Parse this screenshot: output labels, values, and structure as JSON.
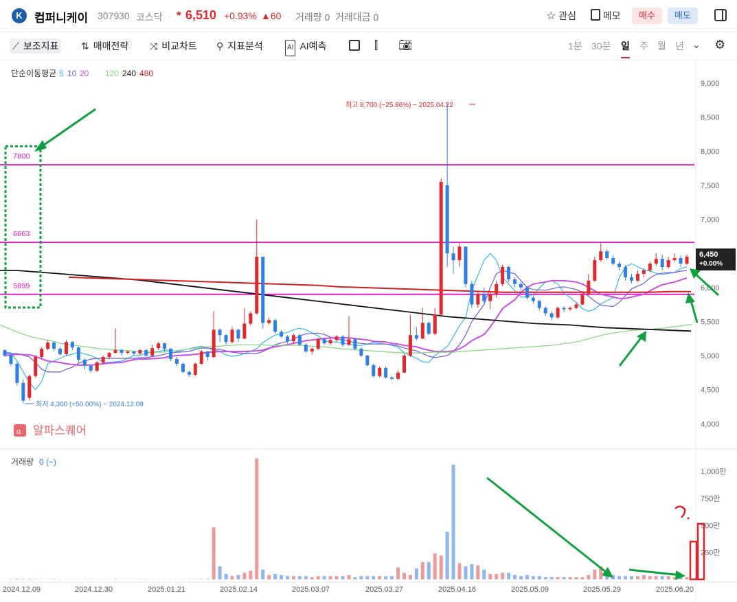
{
  "header": {
    "logo_glyph": "꒰",
    "name": "컴퍼니케이",
    "code": "307930",
    "market": "코스닥",
    "star": "*",
    "price": "6,510",
    "change_pct": "+0.93%",
    "change_abs": "▲60",
    "volume_label": "거래량 0",
    "amount_label": "거래대금 0",
    "watch_label": "관심",
    "memo_label": "메모",
    "buy_label": "매수",
    "sell_label": "매도"
  },
  "toolbar": {
    "tools": [
      "보조지표",
      "매매전략",
      "비교차트",
      "지표분석",
      "AI예측"
    ],
    "periods": [
      "1분",
      "30분",
      "일",
      "주",
      "월",
      "년"
    ],
    "active_period": "일"
  },
  "colors": {
    "up": "#e0282e",
    "down": "#2f7ee6",
    "ma5": "#35b8e6",
    "ma10": "#6a5ae0",
    "ma20": "#c84fe0",
    "ma120": "#7fd87a",
    "ma240": "#111111",
    "ma480": "#d41e1e",
    "hline": "#e020c8",
    "annot": "#10a040"
  },
  "chart_data": {
    "type": "candlestick",
    "ma_legend": {
      "title": "단순이동평균",
      "items": [
        {
          "label": "5",
          "color": "#35b8e6"
        },
        {
          "label": "10",
          "color": "#6a5ae0"
        },
        {
          "label": "20",
          "color": "#c84fe0"
        },
        {
          "label": "120",
          "color": "#7fd87a"
        },
        {
          "label": "240",
          "color": "#111111"
        },
        {
          "label": "480",
          "color": "#d41e1e"
        }
      ]
    },
    "price_axis": {
      "ticks": [
        "9,000",
        "8,500",
        "8,000",
        "7,500",
        "7,000",
        "6,500",
        "6,000",
        "5,500",
        "5,000",
        "4,500",
        "4,000"
      ],
      "values": [
        9000,
        8500,
        8000,
        7500,
        7000,
        6500,
        6000,
        5500,
        5000,
        4500,
        4000
      ]
    },
    "x_labels": [
      "2024.12.09",
      "2024.12.30",
      "2025.01.21",
      "2025.02.14",
      "2025.03.07",
      "2025.03.27",
      "2025.04.16",
      "2025.05.09",
      "2025.05.29",
      "2025.06.20"
    ],
    "current_price_tag": {
      "price": "6,450",
      "pct": "+0.00%"
    },
    "high_label": "최고 8,700 (−25.86%) − 2025.04.22",
    "low_label": "최저 4,300 (+50.00%) − 2024.12.09",
    "horizontal_lines": [
      {
        "label": "7800",
        "value": 7800
      },
      {
        "label": "6663",
        "value": 6663
      },
      {
        "label": "5899",
        "value": 5899
      }
    ],
    "watermark": "알파스퀘어",
    "volume": {
      "title": "거래량",
      "value_text": "0 (−)",
      "ticks": [
        "1,000만",
        "750만",
        "500만",
        "250만"
      ],
      "tick_values": [
        1000,
        750,
        500,
        250
      ],
      "unit": "만"
    },
    "series": [
      {
        "name": "5",
        "values": [
          5050,
          5040,
          4920,
          4600,
          4500,
          4620,
          4880,
          4960,
          5000,
          5020,
          5050,
          5000,
          4960,
          4900,
          4900,
          4920,
          4960,
          5000,
          5000,
          5040,
          5060,
          5080,
          5080,
          5060,
          5100,
          5120,
          5140,
          5110,
          5060,
          5010,
          4990,
          5000,
          5030,
          5100,
          5190,
          5250,
          5300,
          5340,
          5380,
          5400,
          5380,
          5290,
          5220,
          5200,
          5200,
          5170,
          5150,
          5150,
          5170,
          5190,
          5170,
          5150,
          5120,
          5040,
          4960,
          4910,
          4900,
          5000,
          5130,
          5280,
          5440,
          5560,
          5960,
          6400,
          6500,
          6400,
          6150,
          5950,
          5860,
          5860,
          5900,
          6080,
          6100,
          6050,
          5920,
          5780,
          5690,
          5650,
          5680,
          5760,
          5850,
          6150,
          6300,
          6350,
          6260,
          6240,
          6210,
          6190,
          6220,
          6280,
          6300
        ]
      },
      {
        "name": "10",
        "values": [
          5030,
          5030,
          5030,
          4980,
          4900,
          4800,
          4760,
          4760,
          4800,
          4830,
          4890,
          4950,
          4960,
          4960,
          4960,
          4960,
          4960,
          4960,
          4970,
          4970,
          5000,
          5020,
          5040,
          5050,
          5060,
          5090,
          5110,
          5110,
          5090,
          5070,
          5050,
          5040,
          5030,
          5030,
          5060,
          5100,
          5160,
          5210,
          5240,
          5290,
          5320,
          5330,
          5310,
          5270,
          5240,
          5210,
          5190,
          5180,
          5170,
          5170,
          5170,
          5160,
          5140,
          5110,
          5070,
          5030,
          4990,
          4970,
          5000,
          5060,
          5160,
          5300,
          5500,
          5750,
          6000,
          6200,
          6250,
          6200,
          6100,
          6000,
          5970,
          5960,
          5980,
          6000,
          6010,
          5970,
          5930,
          5870,
          5800,
          5740,
          5720,
          5780,
          5880,
          5980,
          6060,
          6140,
          6190,
          6210,
          6220,
          6240,
          6250
        ]
      },
      {
        "name": "20",
        "values": [
          5000,
          5010,
          5020,
          5010,
          4990,
          4950,
          4920,
          4900,
          4880,
          4870,
          4860,
          4860,
          4870,
          4880,
          4890,
          4900,
          4920,
          4940,
          4950,
          4950,
          4960,
          4970,
          4990,
          5000,
          5010,
          5020,
          5030,
          5050,
          5060,
          5060,
          5060,
          5060,
          5060,
          5070,
          5080,
          5110,
          5130,
          5160,
          5180,
          5200,
          5220,
          5240,
          5250,
          5260,
          5260,
          5260,
          5250,
          5240,
          5230,
          5210,
          5200,
          5180,
          5170,
          5150,
          5130,
          5100,
          5080,
          5060,
          5060,
          5070,
          5100,
          5150,
          5220,
          5310,
          5420,
          5550,
          5690,
          5820,
          5930,
          6000,
          6050,
          6080,
          6100,
          6100,
          6100,
          6080,
          6050,
          6000,
          5950,
          5900,
          5860,
          5840,
          5840,
          5860,
          5900,
          5950,
          6000,
          6040,
          6080,
          6110,
          6140
        ]
      },
      {
        "name": "120",
        "values": [
          5450,
          5390,
          5330,
          5280,
          5250,
          5220,
          5180,
          5160,
          5140,
          5120,
          5100,
          5090,
          5080,
          5070,
          5060,
          5050,
          5050,
          5060,
          5080,
          5100,
          5120,
          5130,
          5140,
          5150,
          5160,
          5160,
          5160,
          5150,
          5150,
          5150,
          5150,
          5140,
          5130,
          5120,
          5100,
          5090,
          5080,
          5070,
          5060,
          5050,
          5040,
          5040,
          5040,
          5050,
          5050,
          5050,
          5060,
          5070,
          5080,
          5090,
          5100,
          5110,
          5120,
          5130,
          5140,
          5150,
          5170,
          5190,
          5220,
          5260,
          5300,
          5330,
          5350,
          5370,
          5380,
          5390,
          5400,
          5420,
          5440,
          5460
        ]
      },
      {
        "name": "240",
        "values": [
          6250,
          6250,
          6230,
          6210,
          6190,
          6170,
          6150,
          6130,
          6110,
          6080,
          6050,
          6020,
          5990,
          5960,
          5930,
          5900,
          5870,
          5840,
          5810,
          5780,
          5750,
          5720,
          5690,
          5660,
          5630,
          5600,
          5570,
          5550,
          5530,
          5510,
          5490,
          5470,
          5460,
          5450,
          5430,
          5410,
          5400,
          5390,
          5380,
          5370,
          5360
        ]
      },
      {
        "name": "480",
        "values": [
          6150,
          6140,
          6130,
          6120,
          6110,
          6100,
          6090,
          6080,
          6070,
          6060,
          6050,
          6040,
          6030,
          6010,
          6000,
          5990,
          5980,
          5970,
          5960,
          5950,
          5940,
          5930,
          5930,
          5930,
          5930,
          5930,
          5930,
          5930,
          5930,
          5940,
          5940
        ]
      }
    ],
    "candles": [
      [
        5080,
        5000,
        5090,
        4980
      ],
      [
        5000,
        4880,
        5020,
        4850
      ],
      [
        4880,
        4600,
        4900,
        4560
      ],
      [
        4600,
        4340,
        4650,
        4300
      ],
      [
        4380,
        4700,
        4720,
        4340
      ],
      [
        4700,
        4980,
        5000,
        4680
      ],
      [
        4980,
        5100,
        5120,
        4960
      ],
      [
        5100,
        5190,
        5230,
        5080
      ],
      [
        5190,
        5100,
        5200,
        5060
      ],
      [
        5100,
        5020,
        5130,
        5000
      ],
      [
        5020,
        5200,
        5230,
        5000
      ],
      [
        5200,
        5120,
        5210,
        5080
      ],
      [
        5120,
        4940,
        5130,
        4900
      ],
      [
        4940,
        4850,
        4960,
        4800
      ],
      [
        4850,
        4780,
        4870,
        4750
      ],
      [
        4780,
        4900,
        4920,
        4760
      ],
      [
        4900,
        4980,
        5000,
        4880
      ],
      [
        4980,
        5040,
        5050,
        4950
      ],
      [
        5040,
        5080,
        5400,
        5030
      ],
      [
        5080,
        5040,
        5100,
        5000
      ],
      [
        5040,
        5060,
        5080,
        5020
      ],
      [
        5060,
        5030,
        5070,
        5000
      ],
      [
        5030,
        5080,
        5090,
        5010
      ],
      [
        5080,
        5000,
        5100,
        4980
      ],
      [
        5000,
        5110,
        5160,
        4990
      ],
      [
        5110,
        5180,
        5200,
        5080
      ],
      [
        5180,
        5100,
        5190,
        5060
      ],
      [
        5100,
        4950,
        5110,
        4920
      ],
      [
        4950,
        4880,
        4980,
        4850
      ],
      [
        4880,
        4760,
        4900,
        4740
      ],
      [
        4760,
        4720,
        4780,
        4690
      ],
      [
        4720,
        4880,
        4900,
        4700
      ],
      [
        4880,
        5060,
        5080,
        4870
      ],
      [
        5060,
        4980,
        5070,
        4930
      ],
      [
        4980,
        5380,
        5650,
        4960
      ],
      [
        5380,
        5300,
        5400,
        5200
      ],
      [
        5300,
        5200,
        5320,
        5160
      ],
      [
        5200,
        5380,
        5420,
        5180
      ],
      [
        5380,
        5250,
        5390,
        5200
      ],
      [
        5250,
        5470,
        5700,
        5240
      ],
      [
        5470,
        5620,
        5650,
        5440
      ],
      [
        5620,
        6450,
        7000,
        5600
      ],
      [
        6450,
        5480,
        6450,
        5400
      ],
      [
        5480,
        5520,
        5560,
        5450
      ],
      [
        5520,
        5350,
        5540,
        5320
      ],
      [
        5350,
        5280,
        5380,
        5260
      ],
      [
        5280,
        5210,
        5300,
        5180
      ],
      [
        5210,
        5300,
        5320,
        5180
      ],
      [
        5300,
        5160,
        5320,
        5140
      ],
      [
        5160,
        5060,
        5180,
        5040
      ],
      [
        5060,
        5100,
        5120,
        5020
      ],
      [
        5100,
        5240,
        5260,
        5080
      ],
      [
        5240,
        5180,
        5260,
        5160
      ],
      [
        5180,
        5230,
        5250,
        5160
      ],
      [
        5230,
        5280,
        5300,
        5200
      ],
      [
        5280,
        5160,
        5300,
        5130
      ],
      [
        5160,
        5240,
        5580,
        5140
      ],
      [
        5240,
        5100,
        5260,
        5080
      ],
      [
        5100,
        5000,
        5120,
        4980
      ],
      [
        5000,
        4860,
        5010,
        4840
      ],
      [
        4860,
        4700,
        4880,
        4680
      ],
      [
        4700,
        4820,
        4840,
        4680
      ],
      [
        4820,
        4680,
        4840,
        4660
      ],
      [
        4680,
        4660,
        4700,
        4640
      ],
      [
        4660,
        4750,
        4780,
        4640
      ],
      [
        4750,
        5000,
        5030,
        4740
      ],
      [
        5000,
        5300,
        5600,
        4980
      ],
      [
        5300,
        5250,
        5420,
        5220
      ],
      [
        5250,
        5480,
        5700,
        5240
      ],
      [
        5480,
        5320,
        5500,
        5300
      ],
      [
        5320,
        5600,
        5700,
        5300
      ],
      [
        5600,
        7550,
        7600,
        5600
      ],
      [
        7500,
        6500,
        8700,
        6300
      ],
      [
        6500,
        6400,
        6600,
        6200
      ],
      [
        6400,
        6600,
        6650,
        6300
      ],
      [
        6600,
        6050,
        6600,
        6000
      ],
      [
        6050,
        5750,
        6100,
        5700
      ],
      [
        5750,
        5900,
        5950,
        5700
      ],
      [
        5900,
        5800,
        6000,
        5750
      ],
      [
        5800,
        5900,
        5950,
        5680
      ],
      [
        5900,
        6050,
        6100,
        5850
      ],
      [
        6050,
        6300,
        6330,
        6020
      ],
      [
        6300,
        6120,
        6320,
        6080
      ],
      [
        6120,
        6050,
        6150,
        6000
      ],
      [
        6050,
        6000,
        6080,
        5950
      ],
      [
        6000,
        5850,
        6020,
        5820
      ],
      [
        5850,
        5800,
        5900,
        5760
      ],
      [
        5800,
        5700,
        5820,
        5660
      ],
      [
        5700,
        5620,
        5720,
        5580
      ],
      [
        5620,
        5560,
        5650,
        5520
      ],
      [
        5560,
        5700,
        5720,
        5540
      ],
      [
        5700,
        5680,
        5720,
        5640
      ],
      [
        5680,
        5700,
        5720,
        5660
      ],
      [
        5700,
        5750,
        5780,
        5680
      ],
      [
        5750,
        5900,
        5950,
        5740
      ],
      [
        5900,
        6100,
        6200,
        5880
      ],
      [
        6100,
        6400,
        6450,
        6080
      ],
      [
        6400,
        6530,
        6650,
        6380
      ],
      [
        6530,
        6430,
        6560,
        6400
      ],
      [
        6430,
        6350,
        6470,
        6320
      ],
      [
        6350,
        6300,
        6380,
        6250
      ],
      [
        6300,
        6150,
        6330,
        6100
      ],
      [
        6150,
        6100,
        6200,
        6060
      ],
      [
        6100,
        6200,
        6250,
        6080
      ],
      [
        6200,
        6250,
        6280,
        6150
      ],
      [
        6250,
        6350,
        6380,
        6230
      ],
      [
        6350,
        6420,
        6500,
        6320
      ],
      [
        6420,
        6300,
        6480,
        6250
      ],
      [
        6300,
        6400,
        6450,
        6280
      ],
      [
        6400,
        6430,
        6500,
        6380
      ],
      [
        6430,
        6350,
        6470,
        6300
      ],
      [
        6350,
        6450,
        6480,
        6330
      ]
    ],
    "volumes": [
      1,
      3,
      6,
      4,
      4,
      3,
      2,
      2,
      3,
      2,
      2,
      2,
      2,
      2,
      2,
      2,
      2,
      2,
      3,
      2,
      2,
      2,
      2,
      2,
      2,
      2,
      2,
      2,
      2,
      2,
      2,
      2,
      3,
      4,
      480,
      120,
      50,
      30,
      40,
      60,
      80,
      1120,
      90,
      40,
      50,
      40,
      30,
      30,
      30,
      30,
      20,
      30,
      30,
      30,
      30,
      30,
      40,
      20,
      30,
      30,
      30,
      30,
      30,
      30,
      110,
      60,
      40,
      100,
      160,
      160,
      240,
      220,
      440,
      1060,
      150,
      120,
      140,
      130,
      90,
      50,
      50,
      60,
      60,
      40,
      30,
      40,
      30,
      30,
      20,
      20,
      20,
      20,
      20,
      20,
      20,
      40,
      90,
      120,
      60,
      40,
      30,
      30,
      30,
      30,
      40,
      30,
      30,
      30,
      30,
      20,
      20,
      20,
      30
    ]
  },
  "annotations": {
    "drawn_mark": "?."
  }
}
